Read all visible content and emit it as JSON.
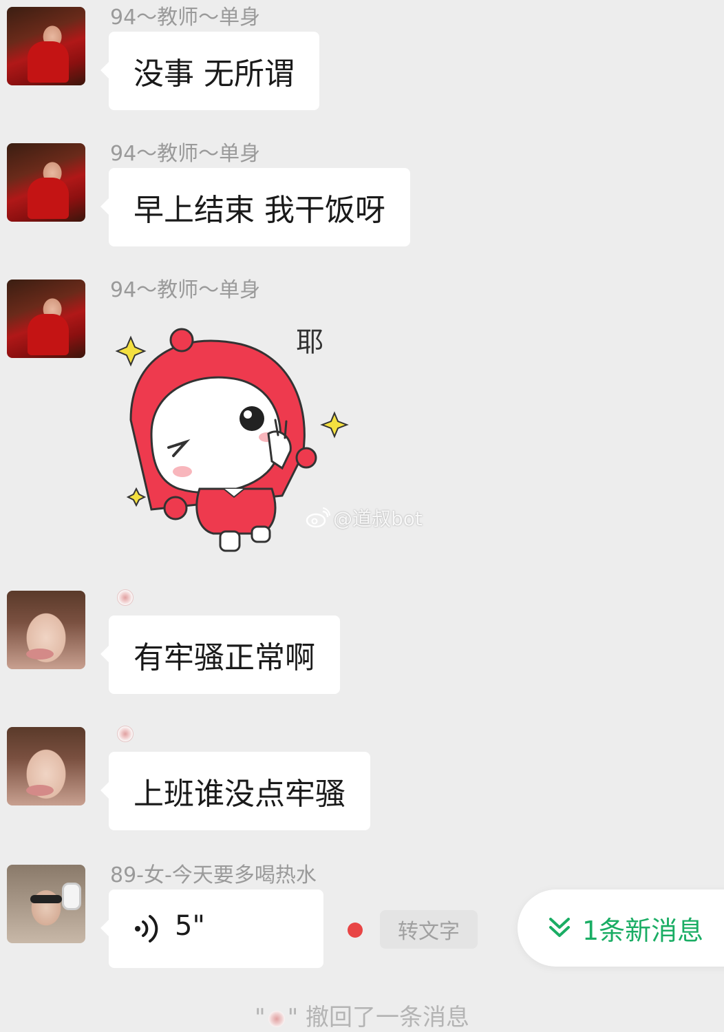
{
  "messages": [
    {
      "sender": "94～教师～单身",
      "text": "没事 无所谓"
    },
    {
      "sender": "94～教师～单身",
      "text": "早上结束 我干饭呀"
    },
    {
      "sender": "94～教师～单身",
      "sticker_text": "耶"
    },
    {
      "sender": "",
      "text": "有牢骚正常啊"
    },
    {
      "sender": "",
      "text": "上班谁没点牢骚"
    },
    {
      "sender": "89-女-今天要多喝热水",
      "voice_duration": "5\""
    }
  ],
  "voice_actions": {
    "to_text_label": "转文字",
    "unread_color": "#e84545"
  },
  "new_message_pill": {
    "label": "1条新消息",
    "accent_color": "#1aad64"
  },
  "recall_notice": {
    "prefix": "\"",
    "suffix": "\" 撤回了一条消息"
  },
  "watermark": "@道叔bot",
  "icons": {
    "voice": "voice-wave-icon",
    "new_message": "double-chevron-down-icon",
    "weibo": "weibo-logo"
  }
}
